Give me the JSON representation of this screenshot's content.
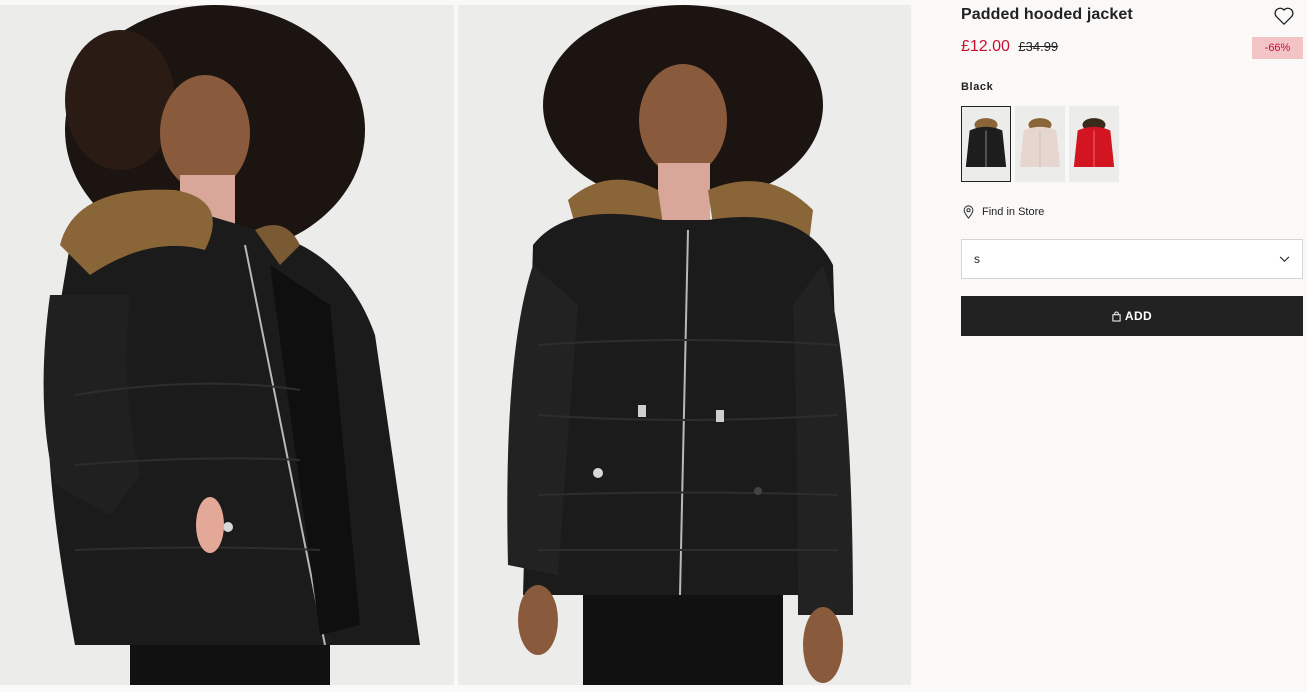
{
  "product": {
    "title": "Padded hooded jacket",
    "price_now": "£12.00",
    "price_was": "£34.99",
    "discount": "-66%"
  },
  "color": {
    "selected_label": "Black",
    "swatches": [
      {
        "name": "black",
        "jacket": "#1d1d1d"
      },
      {
        "name": "light-pink",
        "jacket": "#e6d6cf"
      },
      {
        "name": "red",
        "jacket": "#d31421"
      }
    ]
  },
  "find_in_store": "Find in Store",
  "size": {
    "selected": "s"
  },
  "add_button": "ADD",
  "icons": {
    "favorite": "heart-icon",
    "store": "location-pin-icon",
    "dropdown": "chevron-down-icon",
    "bag": "shopping-bag-icon"
  },
  "colors": {
    "sale": "#c8102e",
    "discount_bg": "#f3c4c6",
    "button_bg": "#222222",
    "page_bg": "#faf9f8"
  }
}
